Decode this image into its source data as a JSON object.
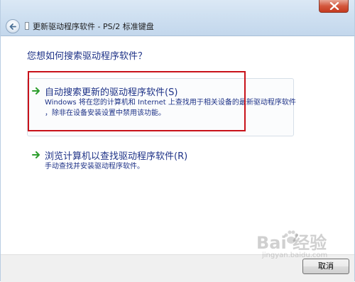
{
  "window": {
    "title": "更新驱动程序软件 - PS/2 标准键盘"
  },
  "main": {
    "question": "您想如何搜索驱动程序软件？",
    "options": [
      {
        "title": "自动搜索更新的驱动程序软件(S)",
        "description_line1": "Windows 将在您的计算机和 Internet 上查找用于相关设备的最新驱动程序软件",
        "description_line2": "，除非在设备安装设置中禁用该功能。"
      },
      {
        "title": "浏览计算机以查找驱动程序软件(R)",
        "description_line1": "手动查找并安装驱动程序软件。"
      }
    ]
  },
  "footer": {
    "cancel_label": "取消"
  },
  "watermark": {
    "logo": "Bai  经验",
    "sub": "jingyan.baidu.com"
  },
  "colors": {
    "accent_text": "#1e3287",
    "arrow_green": "#2e9e2e",
    "highlight_red": "#c8121a"
  }
}
